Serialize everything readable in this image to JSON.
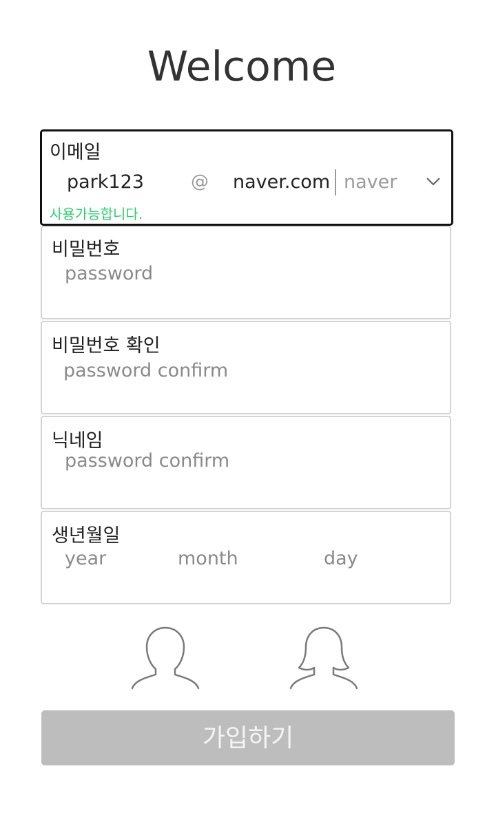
{
  "header": {
    "title": "Welcome"
  },
  "email": {
    "label": "이메일",
    "local_value": "park123",
    "at_symbol": "@",
    "domain_value": "naver.com",
    "domain_select_value": "naver",
    "status_text": "사용가능합니다.",
    "status_color": "#2ecc71"
  },
  "password": {
    "label": "비밀번호",
    "placeholder": "password"
  },
  "password_confirm": {
    "label": "비밀번호 확인",
    "placeholder": "password confirm"
  },
  "nickname": {
    "label": "닉네임",
    "placeholder": "password confirm"
  },
  "birthdate": {
    "label": "생년월일",
    "year_placeholder": "year",
    "month_placeholder": "month",
    "day_placeholder": "day"
  },
  "gender": {
    "options": [
      "male-icon",
      "female-icon"
    ]
  },
  "submit": {
    "label": "가입하기",
    "color": "#bdbdbd"
  }
}
